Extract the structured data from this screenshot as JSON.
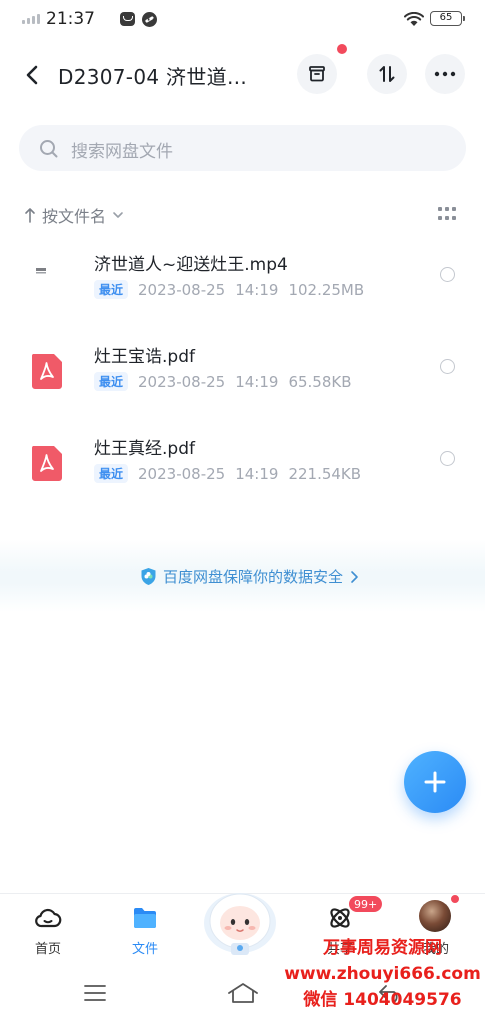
{
  "status_bar": {
    "time": "21:37",
    "more": "···",
    "battery": "65"
  },
  "header": {
    "title": "D2307-04 济世道…",
    "back_icon": "chevron-left-icon",
    "actions": [
      "archive-icon",
      "transfer-icon",
      "more-icon"
    ]
  },
  "search": {
    "placeholder": "搜索网盘文件"
  },
  "sort": {
    "label": "按文件名",
    "view_toggle": "grid-icon"
  },
  "files": [
    {
      "name": "济世道人~迎送灶王.mp4",
      "badge": "最近",
      "date": "2023-08-25",
      "time": "14:19",
      "size": "102.25MB",
      "type": "video"
    },
    {
      "name": "灶王宝诰.pdf",
      "badge": "最近",
      "date": "2023-08-25",
      "time": "14:19",
      "size": "65.58KB",
      "type": "pdf"
    },
    {
      "name": "灶王真经.pdf",
      "badge": "最近",
      "date": "2023-08-25",
      "time": "14:19",
      "size": "221.54KB",
      "type": "pdf"
    }
  ],
  "banner": {
    "text": "百度网盘保障你的数据安全"
  },
  "bottom_nav": {
    "items": [
      {
        "label": "首页",
        "icon": "cloud-icon",
        "active": false
      },
      {
        "label": "文件",
        "icon": "folder-icon",
        "active": true
      },
      {
        "label": "",
        "icon": "mascot-icon",
        "active": false
      },
      {
        "label": "共享",
        "icon": "atom-icon",
        "active": false,
        "badge": "99+"
      },
      {
        "label": "我的",
        "icon": "avatar",
        "active": false
      }
    ]
  },
  "watermark": {
    "line1": "万事周易资源网",
    "line2": "www.zhouyi666.com",
    "line3": "微信 1404049576"
  },
  "colors": {
    "accent": "#2b8bf5",
    "pdf": "#f05a68",
    "alert": "#f24a5c",
    "watermark": "#e8201c"
  }
}
